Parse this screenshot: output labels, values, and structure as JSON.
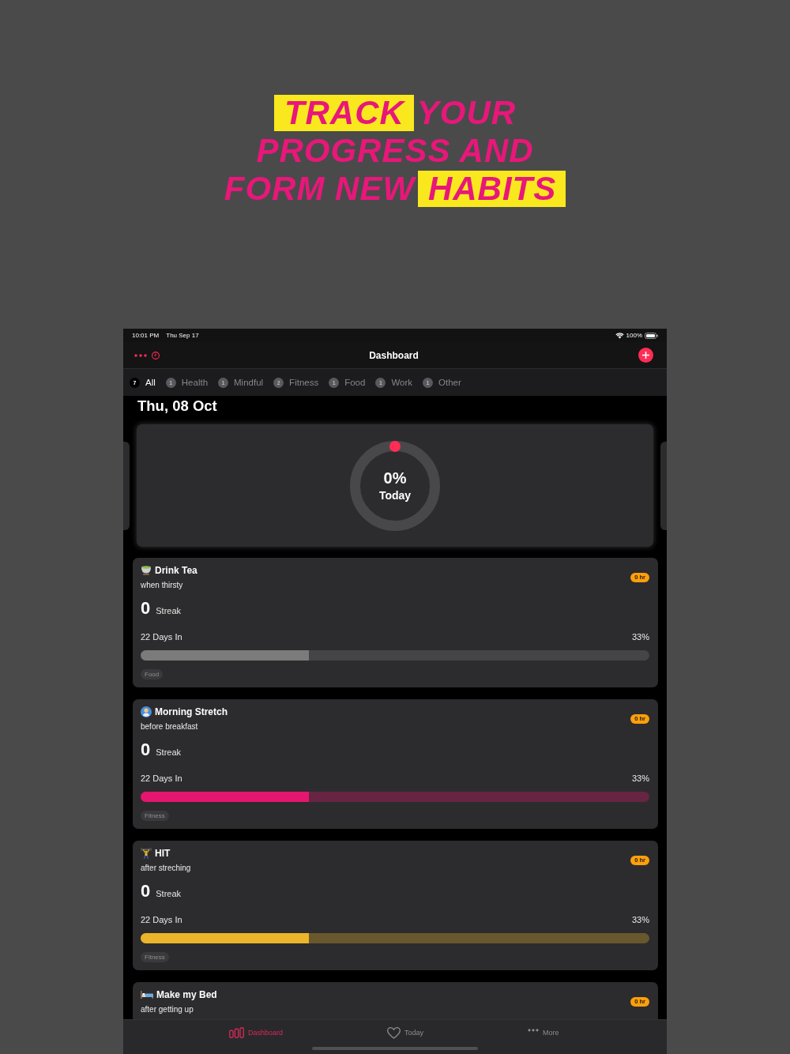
{
  "headline": {
    "lines": [
      [
        {
          "text": "TRACK",
          "highlighted": true
        },
        {
          "text": "YOUR",
          "highlighted": false
        }
      ],
      [
        {
          "text": "PROGRESS AND",
          "highlighted": false
        }
      ],
      [
        {
          "text": "FORM NEW",
          "highlighted": false
        },
        {
          "text": "HABITS",
          "highlighted": true
        }
      ]
    ]
  },
  "status_bar": {
    "time": "10:01 PM",
    "date": "Thu Sep 17",
    "battery": "100%"
  },
  "nav_bar": {
    "title": "Dashboard"
  },
  "filters": [
    {
      "label": "All",
      "count": "7",
      "selected": true
    },
    {
      "label": "Health",
      "count": "1",
      "selected": false
    },
    {
      "label": "Mindful",
      "count": "1",
      "selected": false
    },
    {
      "label": "Fitness",
      "count": "2",
      "selected": false
    },
    {
      "label": "Food",
      "count": "1",
      "selected": false
    },
    {
      "label": "Work",
      "count": "1",
      "selected": false
    },
    {
      "label": "Other",
      "count": "1",
      "selected": false
    }
  ],
  "date_heading": "Thu, 08 Oct",
  "today_progress": {
    "value": "0%",
    "label": "Today"
  },
  "habits": [
    {
      "kind": "tea",
      "title": "Drink Tea",
      "subtitle": "when thirsty",
      "duration": "0 hr",
      "streak": "0",
      "streak_label": "Streak",
      "days": "22 Days In",
      "percent": "33%",
      "level": 0.33,
      "color": "#7b7b7b",
      "tag": "Food"
    },
    {
      "kind": "stretch",
      "title": "Morning Stretch",
      "subtitle": "before breakfast",
      "duration": "0 hr",
      "streak": "0",
      "streak_label": "Streak",
      "days": "22 Days In",
      "percent": "33%",
      "level": 0.33,
      "color": "#e5166f",
      "tag": "Fitness"
    },
    {
      "kind": "lifting",
      "title": "HIT",
      "subtitle": "after streching",
      "duration": "0 hr",
      "streak": "0",
      "streak_label": "Streak",
      "days": "22 Days In",
      "percent": "33%",
      "level": 0.33,
      "color": "#ecb42a",
      "tag": "Fitness"
    },
    {
      "kind": "bed",
      "title": "Make my Bed",
      "subtitle": "after getting up",
      "duration": "0 hr"
    }
  ],
  "tab_bar": [
    {
      "kind": "dashboard",
      "label": "Dashboard",
      "selected": true
    },
    {
      "kind": "today",
      "label": "Today",
      "selected": false
    },
    {
      "kind": "more",
      "label": "More",
      "selected": false
    }
  ]
}
